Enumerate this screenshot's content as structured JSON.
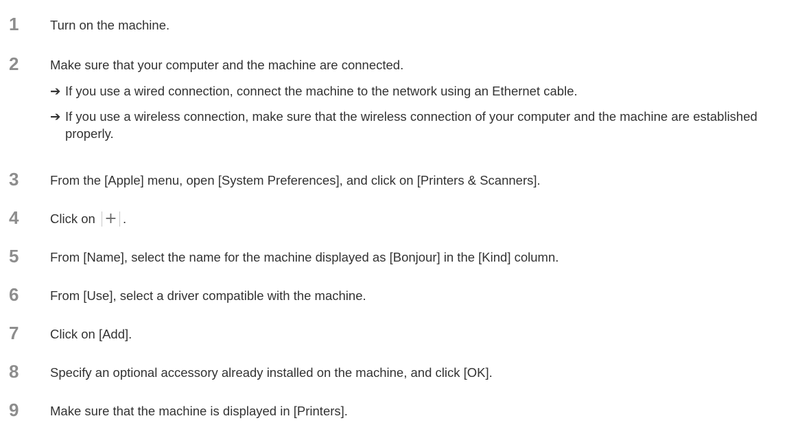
{
  "steps": [
    {
      "num": "1",
      "text": "Turn on the machine."
    },
    {
      "num": "2",
      "text": "Make sure that your computer and the machine are connected.",
      "subs": [
        {
          "arrow": "➔",
          "text": "If you use a wired connection, connect the machine to the network using an Ethernet cable."
        },
        {
          "arrow": "➔",
          "text": "If you use a wireless connection, make sure that the wireless connection of your computer and the machine are established properly."
        }
      ]
    },
    {
      "num": "3",
      "text": "From the [Apple] menu, open [System Preferences], and click on [Printers & Scanners]."
    },
    {
      "num": "4",
      "text_before": "Click on",
      "button_glyph": "+",
      "text_after": "."
    },
    {
      "num": "5",
      "text": "From [Name], select the name for the machine displayed as [Bonjour] in the [Kind] column."
    },
    {
      "num": "6",
      "text": "From [Use], select a driver compatible with the machine."
    },
    {
      "num": "7",
      "text": "Click on [Add]."
    },
    {
      "num": "8",
      "text": "Specify an optional accessory already installed on the machine, and click [OK]."
    },
    {
      "num": "9",
      "text": "Make sure that the machine is displayed in [Printers]."
    }
  ]
}
